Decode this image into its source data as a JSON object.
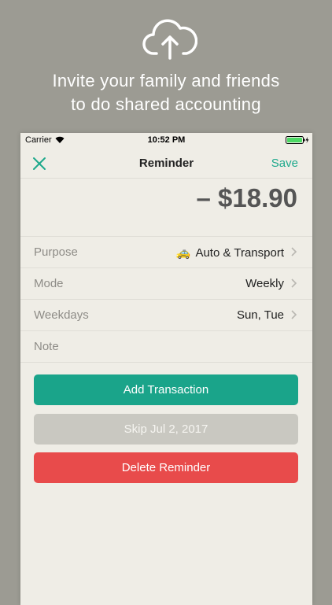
{
  "promo": {
    "icon": "cloud-upload-icon",
    "headline_line1": "Invite your family and friends",
    "headline_line2": "to do shared accounting"
  },
  "status_bar": {
    "carrier": "Carrier",
    "time": "10:52 PM"
  },
  "nav": {
    "title": "Reminder",
    "save_label": "Save"
  },
  "amount": "– $18.90",
  "fields": {
    "purpose": {
      "label": "Purpose",
      "value": "Auto & Transport",
      "icon": "taxi-icon"
    },
    "mode": {
      "label": "Mode",
      "value": "Weekly"
    },
    "weekdays": {
      "label": "Weekdays",
      "value": "Sun, Tue"
    },
    "note": {
      "label": "Note",
      "value": ""
    }
  },
  "buttons": {
    "add": "Add Transaction",
    "skip": "Skip Jul 2, 2017",
    "delete": "Delete Reminder"
  },
  "colors": {
    "accent": "#1aa48a",
    "danger": "#e84b4b",
    "disabled": "#c9c8c1",
    "background": "#9c9b93"
  }
}
